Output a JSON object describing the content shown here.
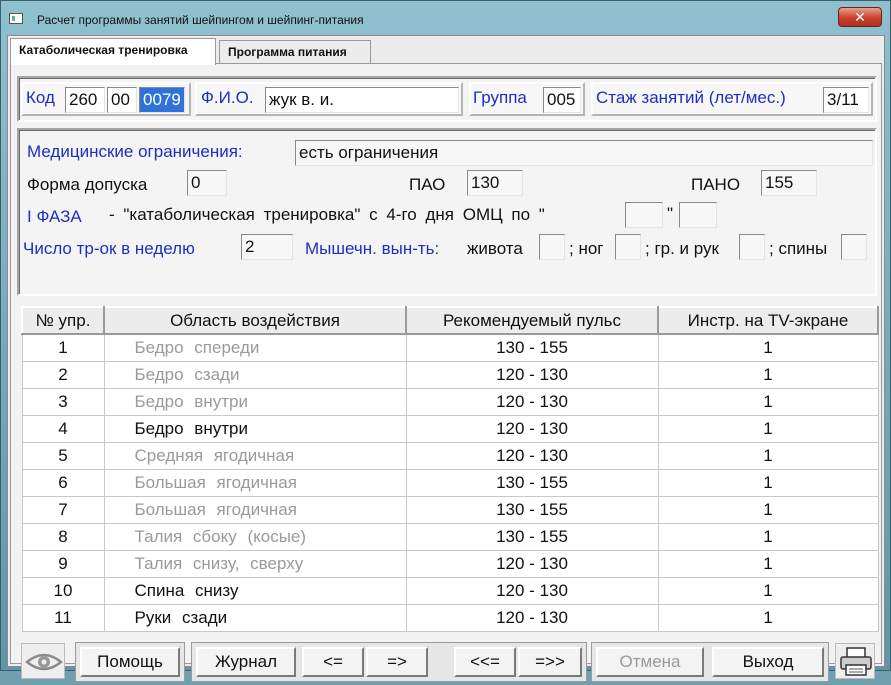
{
  "window": {
    "title": "Расчет программы занятий шейпингом и шейпинг-питания",
    "close_label": "✕"
  },
  "tabs": [
    {
      "label": "Катаболическая тренировка",
      "active": true
    },
    {
      "label": "Программа питания",
      "active": false
    }
  ],
  "header": {
    "kod_label": "Код",
    "kod_values": [
      "260",
      "00",
      "0079"
    ],
    "fio_label": "Ф.И.О.",
    "fio_value": "жук в. и.",
    "group_label": "Группа",
    "group_value": "005",
    "stazh_label": "Стаж занятий (лет/мес.)",
    "stazh_value": "3/11"
  },
  "medical": {
    "restrictions_label": "Медицинские ограничения:",
    "restrictions_value": "есть ограничения",
    "form_label": "Форма допуска",
    "form_value": "0",
    "pao_label": "ПАО",
    "pao_value": "130",
    "pano_label": "ПАНО",
    "pano_value": "155",
    "phase_label": "I ФАЗА",
    "phase_text": "- \"катаболическая тренировка\" с 4-го дня ОМЦ по \"",
    "phase_quote_close": "\"",
    "per_week_label": "Число тр-ок в неделю",
    "per_week_value": "2",
    "muscle_label": "Мышечн. вын-ть:",
    "muscle_items": [
      "живота",
      "; ног",
      "; гр. и рук",
      "; спины"
    ]
  },
  "table": {
    "headers": [
      "№ упр.",
      "Область воздействия",
      "Рекомендуемый пульс",
      "Инстр. на TV-экране"
    ],
    "rows": [
      {
        "num": "1",
        "area": "Бедро спереди",
        "pulse": "130 - 155",
        "instr": "1",
        "active": false
      },
      {
        "num": "2",
        "area": "Бедро сзади",
        "pulse": "120 - 130",
        "instr": "1",
        "active": false
      },
      {
        "num": "3",
        "area": "Бедро внутри",
        "pulse": "120 - 130",
        "instr": "1",
        "active": false
      },
      {
        "num": "4",
        "area": "Бедро внутри",
        "pulse": "120 - 130",
        "instr": "1",
        "active": true
      },
      {
        "num": "5",
        "area": "Средняя ягодичная",
        "pulse": "120 - 130",
        "instr": "1",
        "active": false
      },
      {
        "num": "6",
        "area": "Большая ягодичная",
        "pulse": "130 - 155",
        "instr": "1",
        "active": false
      },
      {
        "num": "7",
        "area": "Большая ягодичная",
        "pulse": "130 - 155",
        "instr": "1",
        "active": false
      },
      {
        "num": "8",
        "area": "Талия сбоку (косые)",
        "pulse": "130 - 155",
        "instr": "1",
        "active": false
      },
      {
        "num": "9",
        "area": "Талия снизу, сверху",
        "pulse": "120 - 130",
        "instr": "1",
        "active": false
      },
      {
        "num": "10",
        "area": "Спина снизу",
        "pulse": "120 - 130",
        "instr": "1",
        "active": true
      },
      {
        "num": "11",
        "area": "Руки сзади",
        "pulse": "120 - 130",
        "instr": "1",
        "active": true
      }
    ]
  },
  "toolbar": {
    "help": "Помощь",
    "journal": "Журнал",
    "prev": "<=",
    "next": "=>",
    "first": "<<=",
    "last": "=>>",
    "cancel": "Отмена",
    "exit": "Выход"
  },
  "icons": {
    "eye": "eye-icon",
    "printer": "printer-icon"
  },
  "colors": {
    "label_blue": "#1c2fc0",
    "selection": "#2f73d8",
    "disabled_text": "#9a9a9a"
  }
}
